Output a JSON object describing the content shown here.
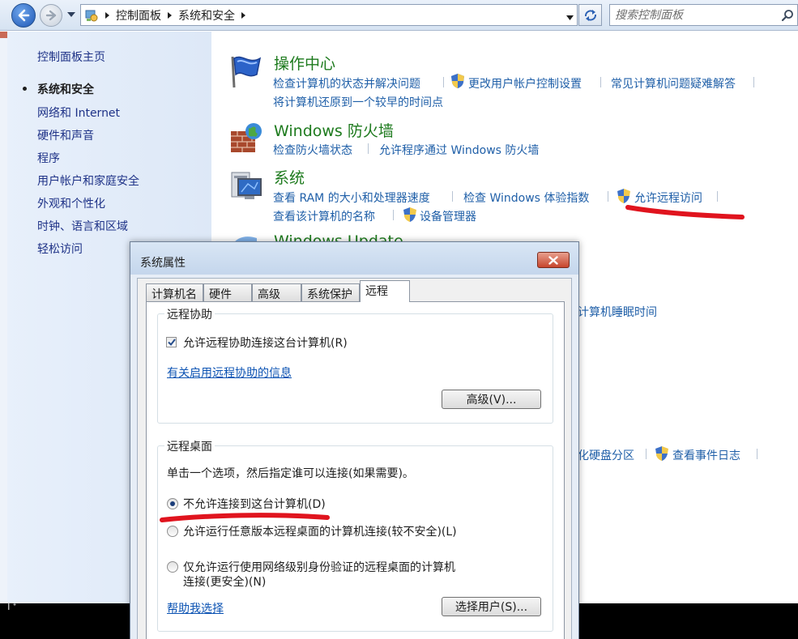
{
  "explorer": {
    "breadcrumb": [
      "控制面板",
      "系统和安全"
    ],
    "search_placeholder": "搜索控制面板"
  },
  "sidebar": {
    "home": "控制面板主页",
    "items": [
      {
        "label": "系统和安全",
        "active": true
      },
      {
        "label": "网络和 Internet"
      },
      {
        "label": "硬件和声音"
      },
      {
        "label": "程序"
      },
      {
        "label": "用户帐户和家庭安全"
      },
      {
        "label": "外观和个性化"
      },
      {
        "label": "时钟、语言和区域"
      },
      {
        "label": "轻松访问"
      }
    ]
  },
  "categories": {
    "action_center": {
      "title": "操作中心",
      "links": [
        "检查计算机的状态并解决问题",
        "更改用户帐户控制设置",
        "常见计算机问题疑难解答",
        "将计算机还原到一个较早的时间点"
      ]
    },
    "firewall": {
      "title": "Windows 防火墙",
      "links": [
        "检查防火墙状态",
        "允许程序通过 Windows 防火墙"
      ]
    },
    "system": {
      "title": "系统",
      "links": [
        "查看 RAM 的大小和处理器速度",
        "检查 Windows 体验指数",
        "允许远程访问",
        "查看该计算机的名称",
        "设备管理器"
      ]
    },
    "windows_update": {
      "title": "Windows Update"
    },
    "partial_links": [
      "计算机睡眠时间",
      "化硬盘分区",
      "查看事件日志"
    ]
  },
  "dialog": {
    "title": "系统属性",
    "tabs": [
      "计算机名",
      "硬件",
      "高级",
      "系统保护",
      "远程"
    ],
    "active_tab": "远程",
    "remote_assistance": {
      "group_label": "远程协助",
      "checkbox_label": "允许远程协助连接这台计算机(R)",
      "checked": true,
      "info_link": "有关启用远程协助的信息",
      "advanced_button": "高级(V)..."
    },
    "remote_desktop": {
      "group_label": "远程桌面",
      "instruction": "单击一个选项，然后指定谁可以连接(如果需要)。",
      "options": [
        {
          "label": "不允许连接到这台计算机(D)",
          "selected": true
        },
        {
          "label": "允许运行任意版本远程桌面的计算机连接(较不安全)(L)",
          "selected": false
        },
        {
          "label": "仅允许运行使用网络级别身份验证的远程桌面的计算机",
          "label_line2": "连接(更安全)(N)",
          "selected": false
        }
      ],
      "help_link": "帮助我选择",
      "select_users_button": "选择用户(S)..."
    }
  },
  "annotations": {
    "color": "#e0141e"
  },
  "colors": {
    "link": "#1f5fa8",
    "category_title": "#1d7a1d",
    "sidebar_link": "#1e3287"
  }
}
